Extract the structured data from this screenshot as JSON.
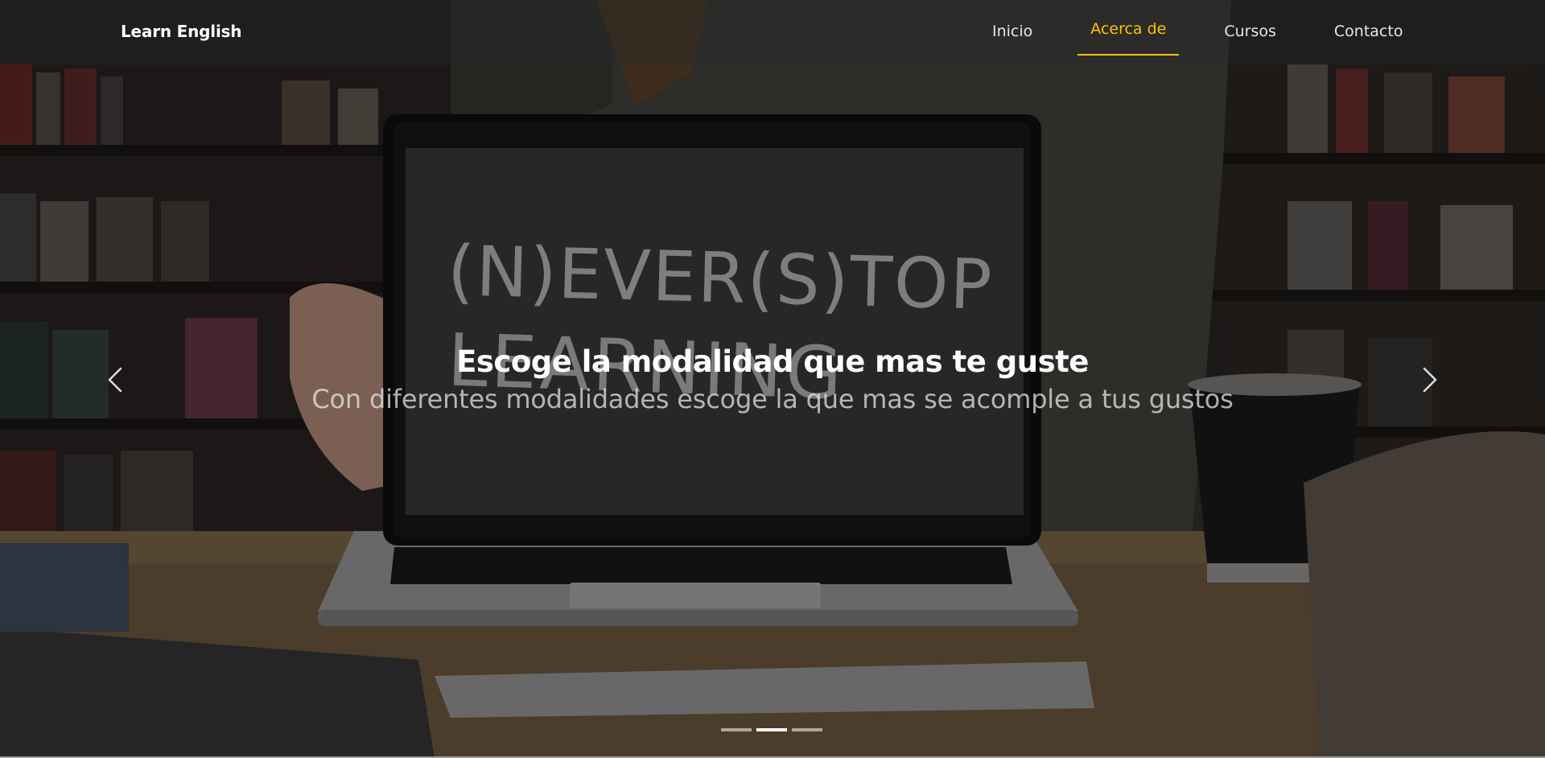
{
  "brand": "Learn English",
  "nav": {
    "items": [
      {
        "label": "Inicio",
        "active": false
      },
      {
        "label": "Acerca de",
        "active": true
      },
      {
        "label": "Cursos",
        "active": false
      },
      {
        "label": "Contacto",
        "active": false
      }
    ]
  },
  "slide": {
    "title": "Escoge la modalidad que mas te guste",
    "subtitle": "Con diferentes modalidades escoge la que mas se acomple a tus gustos",
    "chalk_line_1": "(N)EVER(S)TOP",
    "chalk_line_2": "LEARNING"
  },
  "carousel": {
    "indicator_count": 3,
    "active_index": 1
  },
  "colors": {
    "accent": "#ffc107",
    "text": "#ffffff"
  },
  "icons": {
    "prev": "chevron-left-icon",
    "next": "chevron-right-icon"
  }
}
